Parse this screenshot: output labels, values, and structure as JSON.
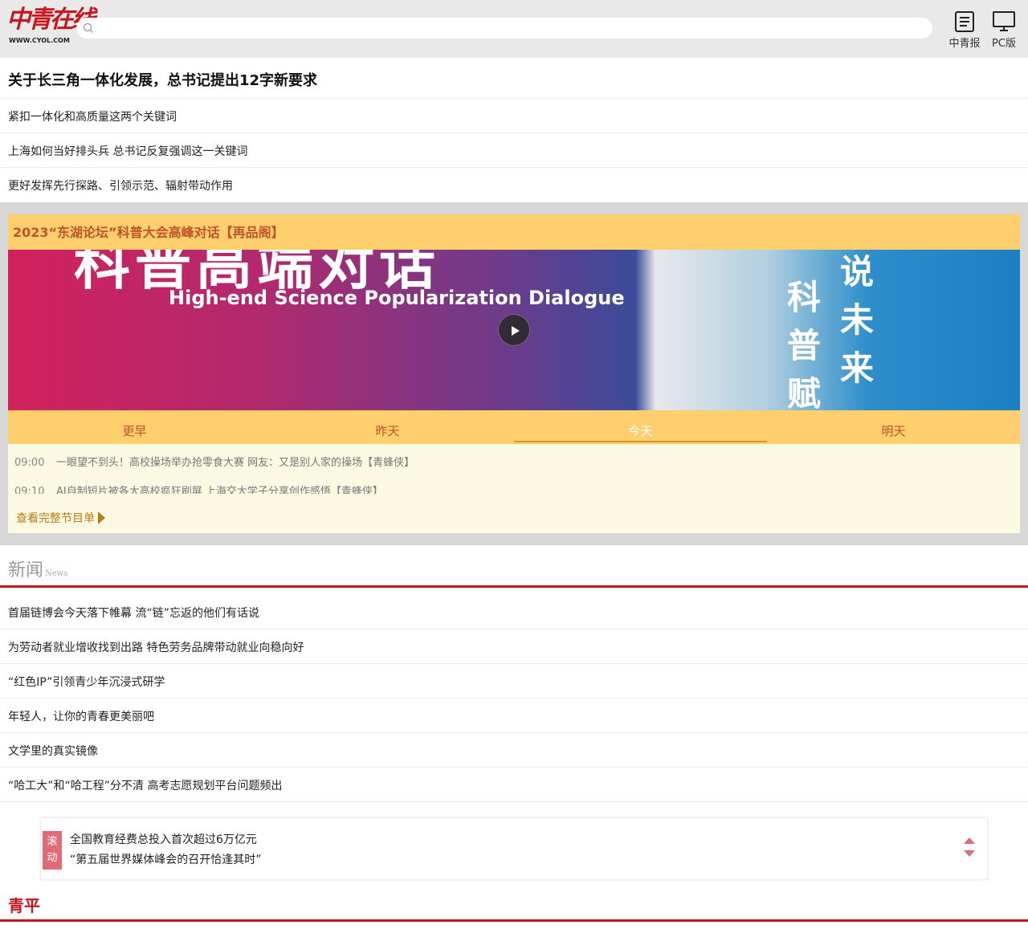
{
  "header": {
    "logo_text": "中青在线",
    "logo_url": "WWW.CYOL.COM",
    "search_placeholder": "",
    "buttons": [
      {
        "label": "中青报",
        "icon": "newspaper-icon"
      },
      {
        "label": "PC版",
        "icon": "monitor-icon"
      }
    ]
  },
  "headline": "关于长三角一体化发展，总书记提出12字新要求",
  "top_links": [
    "紧扣一体化和高质量这两个关键词",
    "上海如何当好排头兵 总书记反复强调这一关键词",
    "更好发挥先行探路、引领示范、辐射带动作用"
  ],
  "video": {
    "title": "2023“东湖论坛”科普大会高峰对话【再品阁】",
    "image_text_big": "科普高端对话",
    "image_text_sub": "High-end Science Popularization Dialogue",
    "image_calligraphy": [
      "说",
      "未",
      "来",
      "科",
      "普",
      "赋"
    ],
    "tabs": [
      {
        "label": "更早",
        "active": false
      },
      {
        "label": "昨天",
        "active": false
      },
      {
        "label": "今天",
        "active": true
      },
      {
        "label": "明天",
        "active": false
      }
    ],
    "schedule": [
      {
        "time": "09:00",
        "title": "一眼望不到头！高校操场举办抢零食大赛 网友：又是别人家的操场【青蜂侠】"
      },
      {
        "time": "09:10",
        "title": "AI自制短片被各大高校疯狂刷屏 上海交大学子分享创作感悟【青蜂侠】"
      }
    ],
    "full_list_link": "查看完整节目单"
  },
  "news_section": {
    "title": "新闻",
    "title_en": "News",
    "items": [
      "首届链博会今天落下帷幕 流“链”忘返的他们有话说",
      "为劳动者就业增收找到出路 特色劳务品牌带动就业向稳向好",
      "“红色IP”引领青少年沉浸式研学",
      "年轻人，让你的青春更美丽吧",
      "文学里的真实镜像",
      "“哈工大”和“哈工程”分不清 高考志愿规划平台问题频出"
    ]
  },
  "ticker": {
    "badge": [
      "滚",
      "动"
    ],
    "lines": [
      "全国教育经费总投入首次超过6万亿元",
      "“第五届世界媒体峰会的召开恰逢其时”"
    ]
  },
  "qingping_section": {
    "title": "青平"
  },
  "colors": {
    "brand_red": "#c8161d",
    "video_yellow": "#fecf6c",
    "video_text": "#c0532a"
  }
}
